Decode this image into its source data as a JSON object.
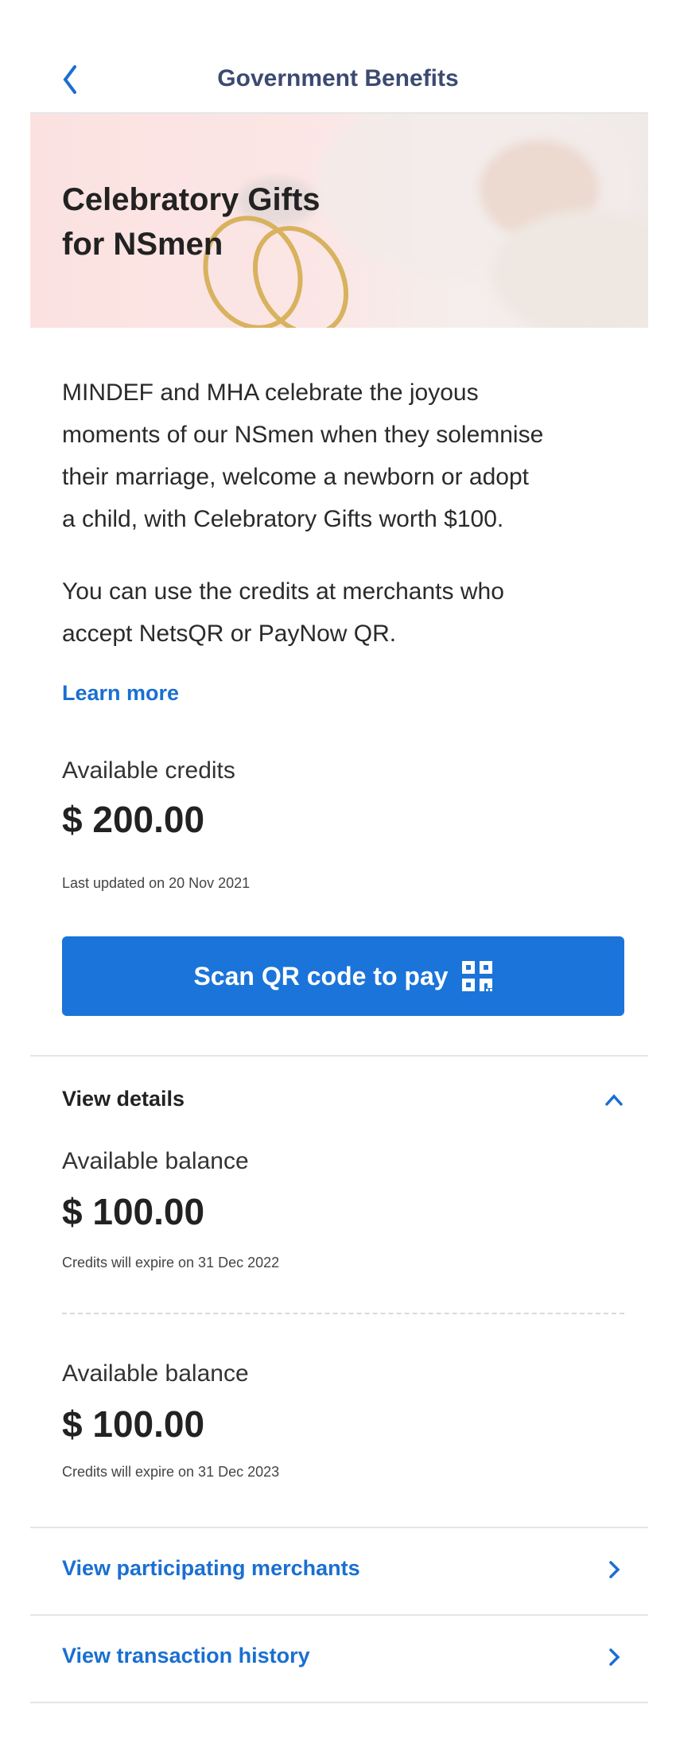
{
  "header": {
    "title": "Government Benefits",
    "back_icon": "chevron-left-icon"
  },
  "banner": {
    "title_line1": "Celebratory Gifts",
    "title_line2": "for NSmen"
  },
  "description": {
    "para1": [
      "MINDEF and MHA celebrate the joyous",
      "moments of our NSmen when they solemnise",
      "their marriage, welcome a newborn or adopt",
      "a child, with Celebratory Gifts worth $100."
    ],
    "para2": [
      "You can use the credits at merchants who",
      "accept NetsQR or PayNow QR."
    ],
    "learn_more": "Learn more"
  },
  "credits": {
    "label": "Available credits",
    "amount": "$ 200.00",
    "updated": "Last updated on 20 Nov 2021"
  },
  "scan_button": {
    "label": "Scan QR code to pay",
    "icon": "qr-code-icon"
  },
  "details": {
    "toggle_label": "View details",
    "expanded": true,
    "balances": [
      {
        "label": "Available balance",
        "amount": "$ 100.00",
        "expiry": "Credits will expire on 31 Dec 2022"
      },
      {
        "label": "Available balance",
        "amount": "$ 100.00",
        "expiry": "Credits will expire on 31 Dec 2023"
      }
    ]
  },
  "links": [
    {
      "label": "View participating merchants"
    },
    {
      "label": "View transaction history"
    }
  ],
  "colors": {
    "accent": "#1b74d9",
    "link": "#1a6fd1",
    "header_title": "#3c4a72"
  }
}
